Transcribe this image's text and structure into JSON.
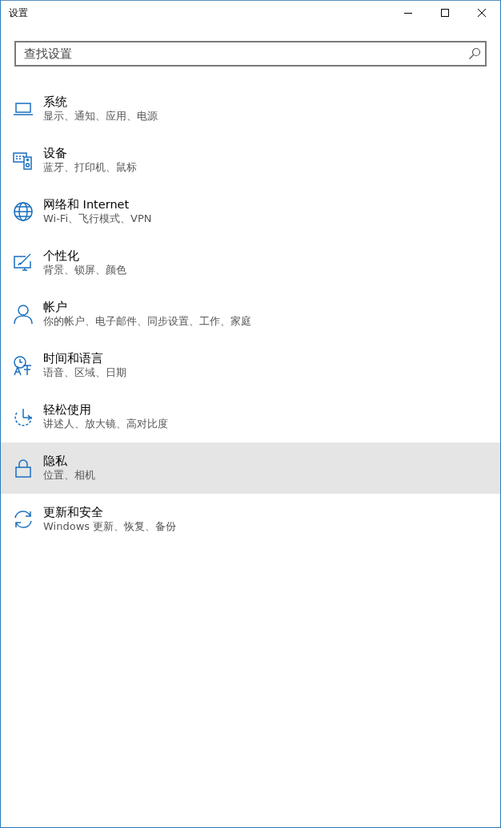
{
  "window": {
    "title": "设置"
  },
  "search": {
    "placeholder": "查找设置"
  },
  "categories": [
    {
      "title": "系统",
      "subtitle": "显示、通知、应用、电源",
      "highlighted": false
    },
    {
      "title": "设备",
      "subtitle": "蓝牙、打印机、鼠标",
      "highlighted": false
    },
    {
      "title": "网络和 Internet",
      "subtitle": "Wi-Fi、飞行模式、VPN",
      "highlighted": false
    },
    {
      "title": "个性化",
      "subtitle": "背景、锁屏、颜色",
      "highlighted": false
    },
    {
      "title": "帐户",
      "subtitle": "你的帐户、电子邮件、同步设置、工作、家庭",
      "highlighted": false
    },
    {
      "title": "时间和语言",
      "subtitle": "语音、区域、日期",
      "highlighted": false
    },
    {
      "title": "轻松使用",
      "subtitle": "讲述人、放大镜、高对比度",
      "highlighted": false
    },
    {
      "title": "隐私",
      "subtitle": "位置、相机",
      "highlighted": true
    },
    {
      "title": "更新和安全",
      "subtitle": "Windows 更新、恢复、备份",
      "highlighted": false
    }
  ]
}
